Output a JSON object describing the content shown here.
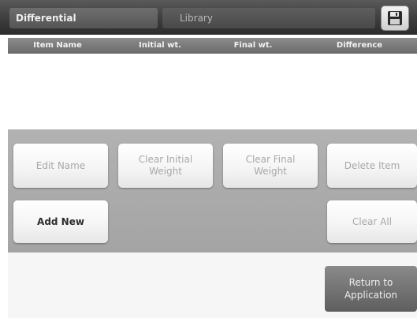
{
  "tabs": [
    {
      "label": "Differential"
    },
    {
      "label": "Library"
    }
  ],
  "icons": {
    "save": "save-disk-icon"
  },
  "table": {
    "columns": [
      "Item Name",
      "Initial wt.",
      "Final wt.",
      "Difference"
    ],
    "rows": []
  },
  "buttons": {
    "edit_name": "Edit Name",
    "clear_initial_weight": "Clear Initial\nWeight",
    "clear_final_weight": "Clear Final\nWeight",
    "delete_item": "Delete Item",
    "add_new": "Add New",
    "clear_all": "Clear All",
    "return_to_application": "Return to\nApplication"
  },
  "colors": {
    "header_bg": "#3d3d3d",
    "panel_bg": "#a9a9a9",
    "disabled_text": "#a8a8a8",
    "enabled_text": "#2e2e2e",
    "return_bg": "#707070"
  }
}
